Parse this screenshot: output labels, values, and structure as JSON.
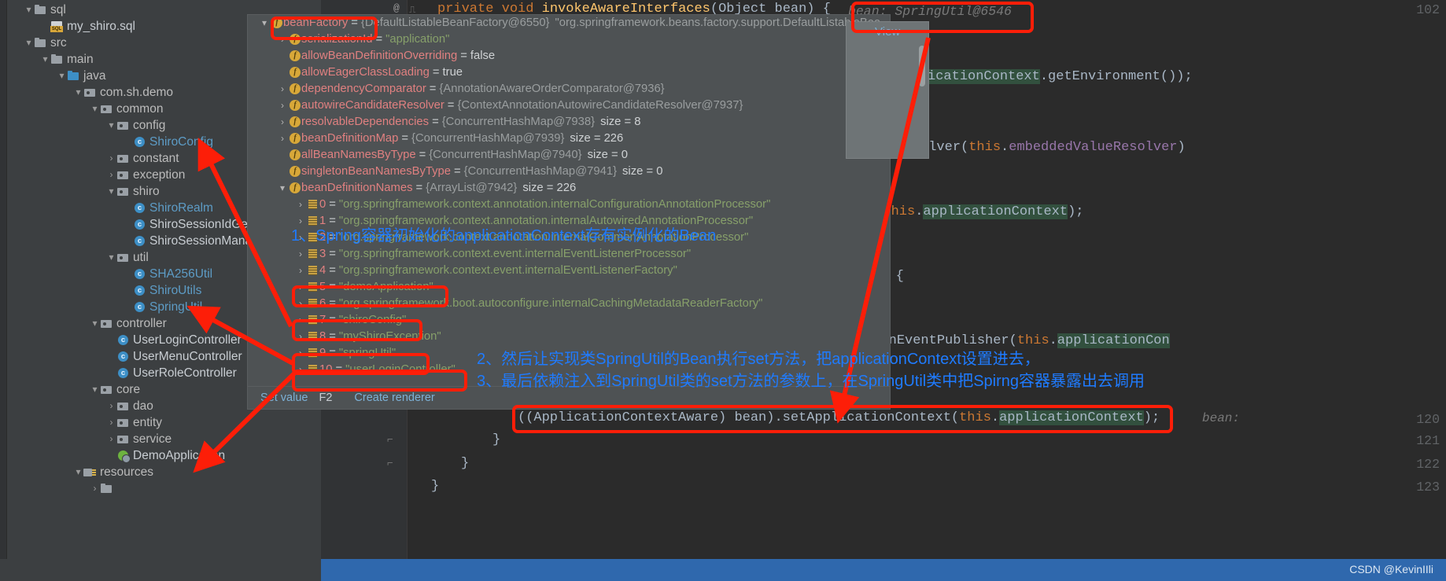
{
  "project_tree": {
    "items": [
      {
        "indent": 1,
        "twisty": "▾",
        "icon": "folder-gray",
        "label": "sql",
        "style": "plain"
      },
      {
        "indent": 2,
        "twisty": "",
        "icon": "sql-file",
        "label": "my_shiro.sql",
        "style": "white"
      },
      {
        "indent": 1,
        "twisty": "▾",
        "icon": "folder-gray",
        "label": "src",
        "style": "plain"
      },
      {
        "indent": 2,
        "twisty": "▾",
        "icon": "folder-gray",
        "label": "main",
        "style": "plain"
      },
      {
        "indent": 3,
        "twisty": "▾",
        "icon": "folder-blue",
        "label": "java",
        "style": "plain"
      },
      {
        "indent": 4,
        "twisty": "▾",
        "icon": "package",
        "label": "com.sh.demo",
        "style": "plain"
      },
      {
        "indent": 5,
        "twisty": "▾",
        "icon": "package",
        "label": "common",
        "style": "plain"
      },
      {
        "indent": 6,
        "twisty": "▾",
        "icon": "package",
        "label": "config",
        "style": "plain"
      },
      {
        "indent": 7,
        "twisty": "",
        "icon": "class",
        "label": "ShiroConfig",
        "style": "blue"
      },
      {
        "indent": 6,
        "twisty": "›",
        "icon": "package",
        "label": "constant",
        "style": "plain"
      },
      {
        "indent": 6,
        "twisty": "›",
        "icon": "package",
        "label": "exception",
        "style": "plain"
      },
      {
        "indent": 6,
        "twisty": "▾",
        "icon": "package",
        "label": "shiro",
        "style": "plain"
      },
      {
        "indent": 7,
        "twisty": "",
        "icon": "class",
        "label": "ShiroRealm",
        "style": "blue"
      },
      {
        "indent": 7,
        "twisty": "",
        "icon": "class",
        "label": "ShiroSessionIdGener",
        "style": "white"
      },
      {
        "indent": 7,
        "twisty": "",
        "icon": "class",
        "label": "ShiroSessionManag",
        "style": "white"
      },
      {
        "indent": 6,
        "twisty": "▾",
        "icon": "package",
        "label": "util",
        "style": "plain"
      },
      {
        "indent": 7,
        "twisty": "",
        "icon": "class",
        "label": "SHA256Util",
        "style": "blue"
      },
      {
        "indent": 7,
        "twisty": "",
        "icon": "class",
        "label": "ShiroUtils",
        "style": "blue"
      },
      {
        "indent": 7,
        "twisty": "",
        "icon": "class",
        "label": "SpringUtil",
        "style": "blue"
      },
      {
        "indent": 5,
        "twisty": "▾",
        "icon": "package",
        "label": "controller",
        "style": "plain"
      },
      {
        "indent": 6,
        "twisty": "",
        "icon": "class",
        "label": "UserLoginController",
        "style": "white"
      },
      {
        "indent": 6,
        "twisty": "",
        "icon": "class",
        "label": "UserMenuController",
        "style": "white"
      },
      {
        "indent": 6,
        "twisty": "",
        "icon": "class",
        "label": "UserRoleController",
        "style": "white"
      },
      {
        "indent": 5,
        "twisty": "▾",
        "icon": "package",
        "label": "core",
        "style": "plain"
      },
      {
        "indent": 6,
        "twisty": "›",
        "icon": "package",
        "label": "dao",
        "style": "plain"
      },
      {
        "indent": 6,
        "twisty": "›",
        "icon": "package",
        "label": "entity",
        "style": "plain"
      },
      {
        "indent": 6,
        "twisty": "›",
        "icon": "package",
        "label": "service",
        "style": "plain"
      },
      {
        "indent": 6,
        "twisty": "",
        "icon": "spring-boot",
        "label": "DemoApplication",
        "style": "white"
      },
      {
        "indent": 4,
        "twisty": "▾",
        "icon": "resources",
        "label": "resources",
        "style": "plain"
      },
      {
        "indent": 5,
        "twisty": "›",
        "icon": "folder-gray",
        "label": "",
        "style": "plain"
      }
    ]
  },
  "debugger": {
    "rows": [
      {
        "indent": 0,
        "twisty": "▾",
        "icon": "field",
        "name": "beanFactory",
        "eq": "=",
        "ref": "{DefaultListableBeanFactory@6550}",
        "value": "\"org.springframework.beans.factory.support.DefaultListableBea...",
        "kind": "ref"
      },
      {
        "indent": 1,
        "twisty": "›",
        "icon": "field",
        "name": "serializationId",
        "eq": "=",
        "ref": "",
        "value": "\"application\"",
        "kind": "string"
      },
      {
        "indent": 1,
        "twisty": "",
        "icon": "field",
        "name": "allowBeanDefinitionOverriding",
        "eq": "=",
        "ref": "",
        "value": "false",
        "kind": "bool"
      },
      {
        "indent": 1,
        "twisty": "",
        "icon": "field",
        "name": "allowEagerClassLoading",
        "eq": "=",
        "ref": "",
        "value": "true",
        "kind": "bool"
      },
      {
        "indent": 1,
        "twisty": "›",
        "icon": "field",
        "name": "dependencyComparator",
        "eq": "=",
        "ref": "{AnnotationAwareOrderComparator@7936}",
        "value": "",
        "kind": "ref"
      },
      {
        "indent": 1,
        "twisty": "›",
        "icon": "field",
        "name": "autowireCandidateResolver",
        "eq": "=",
        "ref": "{ContextAnnotationAutowireCandidateResolver@7937}",
        "value": "",
        "kind": "ref"
      },
      {
        "indent": 1,
        "twisty": "›",
        "icon": "field",
        "name": "resolvableDependencies",
        "eq": "=",
        "ref": "{ConcurrentHashMap@7938}",
        "value": "size = 8",
        "kind": "size"
      },
      {
        "indent": 1,
        "twisty": "›",
        "icon": "field",
        "name": "beanDefinitionMap",
        "eq": "=",
        "ref": "{ConcurrentHashMap@7939}",
        "value": "size = 226",
        "kind": "size"
      },
      {
        "indent": 1,
        "twisty": "",
        "icon": "field",
        "name": "allBeanNamesByType",
        "eq": "=",
        "ref": "{ConcurrentHashMap@7940}",
        "value": "size = 0",
        "kind": "size"
      },
      {
        "indent": 1,
        "twisty": "",
        "icon": "field",
        "name": "singletonBeanNamesByType",
        "eq": "=",
        "ref": "{ConcurrentHashMap@7941}",
        "value": "size = 0",
        "kind": "size"
      },
      {
        "indent": 1,
        "twisty": "▾",
        "icon": "field",
        "name": "beanDefinitionNames",
        "eq": "=",
        "ref": "{ArrayList@7942}",
        "value": "size = 226",
        "kind": "size"
      },
      {
        "indent": 2,
        "twisty": "›",
        "icon": "list",
        "name": "0",
        "eq": "=",
        "ref": "",
        "value": "\"org.springframework.context.annotation.internalConfigurationAnnotationProcessor\"",
        "kind": "string"
      },
      {
        "indent": 2,
        "twisty": "›",
        "icon": "list",
        "name": "1",
        "eq": "=",
        "ref": "",
        "value": "\"org.springframework.context.annotation.internalAutowiredAnnotationProcessor\"",
        "kind": "string"
      },
      {
        "indent": 2,
        "twisty": "›",
        "icon": "list",
        "name": "2",
        "eq": "=",
        "ref": "",
        "value": "\"org.springframework.context.annotation.internalCommonAnnotationProcessor\"",
        "kind": "string"
      },
      {
        "indent": 2,
        "twisty": "›",
        "icon": "list",
        "name": "3",
        "eq": "=",
        "ref": "",
        "value": "\"org.springframework.context.event.internalEventListenerProcessor\"",
        "kind": "string"
      },
      {
        "indent": 2,
        "twisty": "›",
        "icon": "list",
        "name": "4",
        "eq": "=",
        "ref": "",
        "value": "\"org.springframework.context.event.internalEventListenerFactory\"",
        "kind": "string"
      },
      {
        "indent": 2,
        "twisty": "›",
        "icon": "list",
        "name": "5",
        "eq": "=",
        "ref": "",
        "value": "\"demoApplication\"",
        "kind": "string"
      },
      {
        "indent": 2,
        "twisty": "›",
        "icon": "list",
        "name": "6",
        "eq": "=",
        "ref": "",
        "value": "\"org.springframework.boot.autoconfigure.internalCachingMetadataReaderFactory\"",
        "kind": "string"
      },
      {
        "indent": 2,
        "twisty": "›",
        "icon": "list",
        "name": "7",
        "eq": "=",
        "ref": "",
        "value": "\"shiroConfig\"",
        "kind": "string"
      },
      {
        "indent": 2,
        "twisty": "›",
        "icon": "list",
        "name": "8",
        "eq": "=",
        "ref": "",
        "value": "\"myShiroExcention\"",
        "kind": "string"
      },
      {
        "indent": 2,
        "twisty": "›",
        "icon": "list",
        "name": "9",
        "eq": "=",
        "ref": "",
        "value": "\"springUtil\"",
        "kind": "string"
      },
      {
        "indent": 2,
        "twisty": "›",
        "icon": "list",
        "name": "10",
        "eq": "=",
        "ref": "",
        "value": "\"userLoginController\"",
        "kind": "string"
      }
    ],
    "toolbar": {
      "set_value_label": "Set value",
      "set_value_shortcut": "F2",
      "create_renderer_label": "Create renderer"
    },
    "popup": {
      "view_label": "View"
    }
  },
  "editor": {
    "lines": [
      {
        "no": "102",
        "fold": "@",
        "text": "private void invokeAwareInterfaces(Object bean) {"
      },
      {
        "no": "",
        "fold": "",
        "text": ".applicationContext.getEnvironment());"
      },
      {
        "no": "",
        "fold": "",
        "text": "edValueResolver(this.embeddedValueResolver)"
      },
      {
        "no": "",
        "fold": "",
        "text": "r(this.applicationContext);"
      },
      {
        "no": "",
        "fold": "",
        "text": "e) {"
      },
      {
        "no": "",
        "fold": "",
        "text": "olicationEventPublisher(this.applicationCon"
      },
      {
        "no": "120",
        "fold": "",
        "text": "((ApplicationContextAware) bean).setApplicationContext(this.applicationContext);"
      },
      {
        "no": "121",
        "fold": "⌐",
        "text": "}"
      },
      {
        "no": "122",
        "fold": "⌐",
        "text": "}"
      },
      {
        "no": "123",
        "fold": "",
        "text": "}"
      }
    ],
    "inlay_bean_top": "bean: SpringUtil@6546",
    "inlay_bean_right": "bean:",
    "code_120": "((ApplicationContextAware) bean).setApplicationContext(this.applicationContext);"
  },
  "annotations": {
    "note1": "1、Spring容器初始化的applicationContext存有实例化的Bean",
    "note2": "2、然后让实现类SpringUtil的Bean执行set方法，把applicationContext设置进去，",
    "note3": "3、最后依赖注入到SpringUtil类的set方法的参数上，在SpringUtil类中把Spirng容器暴露出去调用",
    "highlight_color": "#fd1e08",
    "note_color": "#1f7bff"
  },
  "status_bar": {
    "watermark": "CSDN @KevinIIli"
  }
}
